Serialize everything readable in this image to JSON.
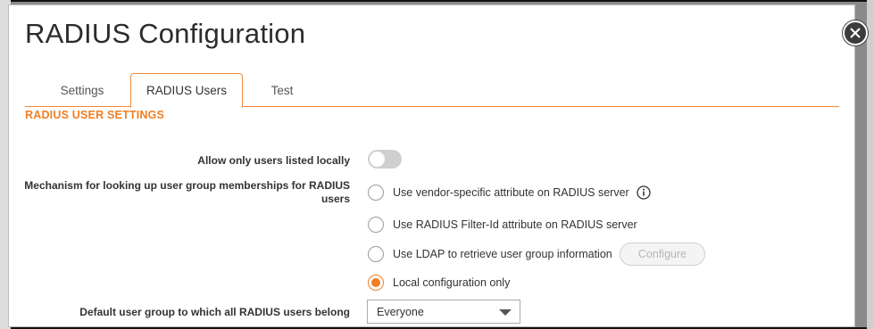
{
  "dialog": {
    "title": "RADIUS Configuration",
    "close_icon": "close-icon"
  },
  "tabs": [
    {
      "label": "Settings",
      "active": false
    },
    {
      "label": "RADIUS Users",
      "active": true
    },
    {
      "label": "Test",
      "active": false
    }
  ],
  "section": {
    "title": "RADIUS USER SETTINGS"
  },
  "form": {
    "allow_local_label": "Allow only users listed locally",
    "allow_local_enabled": false,
    "mechanism_label": "Mechanism for looking up user group memberships for RADIUS users",
    "mechanism_options": [
      {
        "label": "Use vendor-specific attribute on RADIUS server",
        "checked": false,
        "info_icon": "info-icon"
      },
      {
        "label": "Use RADIUS Filter-Id attribute on RADIUS server",
        "checked": false
      },
      {
        "label": "Use LDAP to retrieve user group information",
        "checked": false
      },
      {
        "label": "Local configuration only",
        "checked": true
      }
    ],
    "configure_button": "Configure",
    "default_group_label": "Default user group to which all RADIUS users belong",
    "default_group_value": "Everyone"
  },
  "colors": {
    "accent": "#f07f25",
    "toggle_off": "#cfcfcf"
  }
}
